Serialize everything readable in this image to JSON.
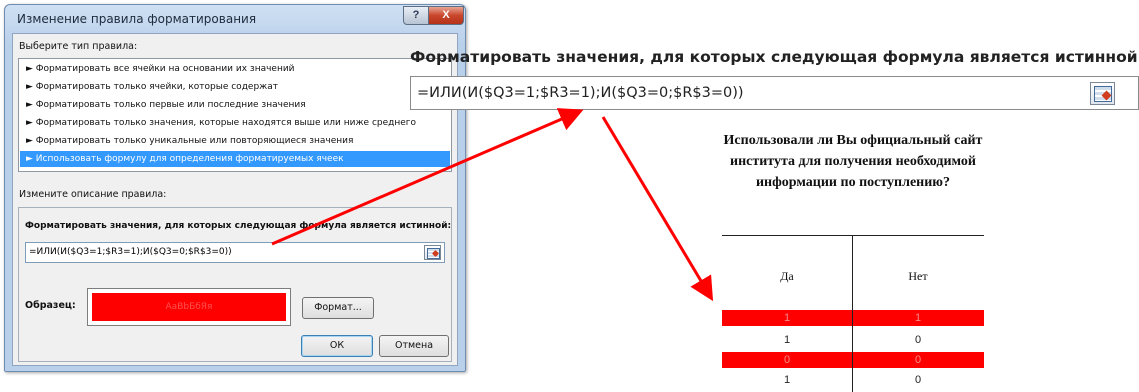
{
  "dialog": {
    "title": "Изменение правила форматирования",
    "select_type_label": "Выберите тип правила:",
    "rule_types": [
      "► Форматировать все ячейки на основании их значений",
      "► Форматировать только ячейки, которые содержат",
      "► Форматировать только первые или последние значения",
      "► Форматировать только значения, которые находятся выше или ниже среднего",
      "► Форматировать только уникальные или повторяющиеся значения",
      "► Использовать формулу для определения форматируемых ячеек"
    ],
    "selected_rule_index": 5,
    "edit_description_label": "Измените описание правила:",
    "formula_label": "Форматировать значения, для которых следующая формула является истинной:",
    "formula_value": "=ИЛИ(И($Q3=1;$R3=1);И($Q3=0;$R$3=0))",
    "preview_label": "Образец:",
    "preview_text": "АаВbБбЯя",
    "preview_fill_color": "#ff0000",
    "format_button": "Формат...",
    "ok_button": "ОК",
    "cancel_button": "Отмена",
    "help_button": "?",
    "close_button": "X"
  },
  "zoom": {
    "heading": "Форматировать значения, для которых следующая формула является истинной",
    "formula_value": "=ИЛИ(И($Q3=1;$R3=1);И($Q3=0;$R$3=0))"
  },
  "survey": {
    "question": "Использовали ли Вы официальный сайт института для получения необходимой информации по поступлению?",
    "columns": [
      "Да",
      "Нет"
    ],
    "rows": [
      {
        "values": [
          "1",
          "1"
        ],
        "highlighted": true
      },
      {
        "values": [
          "1",
          "0"
        ],
        "highlighted": false
      },
      {
        "values": [
          "0",
          "0"
        ],
        "highlighted": true
      },
      {
        "values": [
          "1",
          "0"
        ],
        "highlighted": false
      }
    ],
    "highlight_color": "#ff0000"
  },
  "annotation": {
    "arrow_color": "#ff0000"
  }
}
